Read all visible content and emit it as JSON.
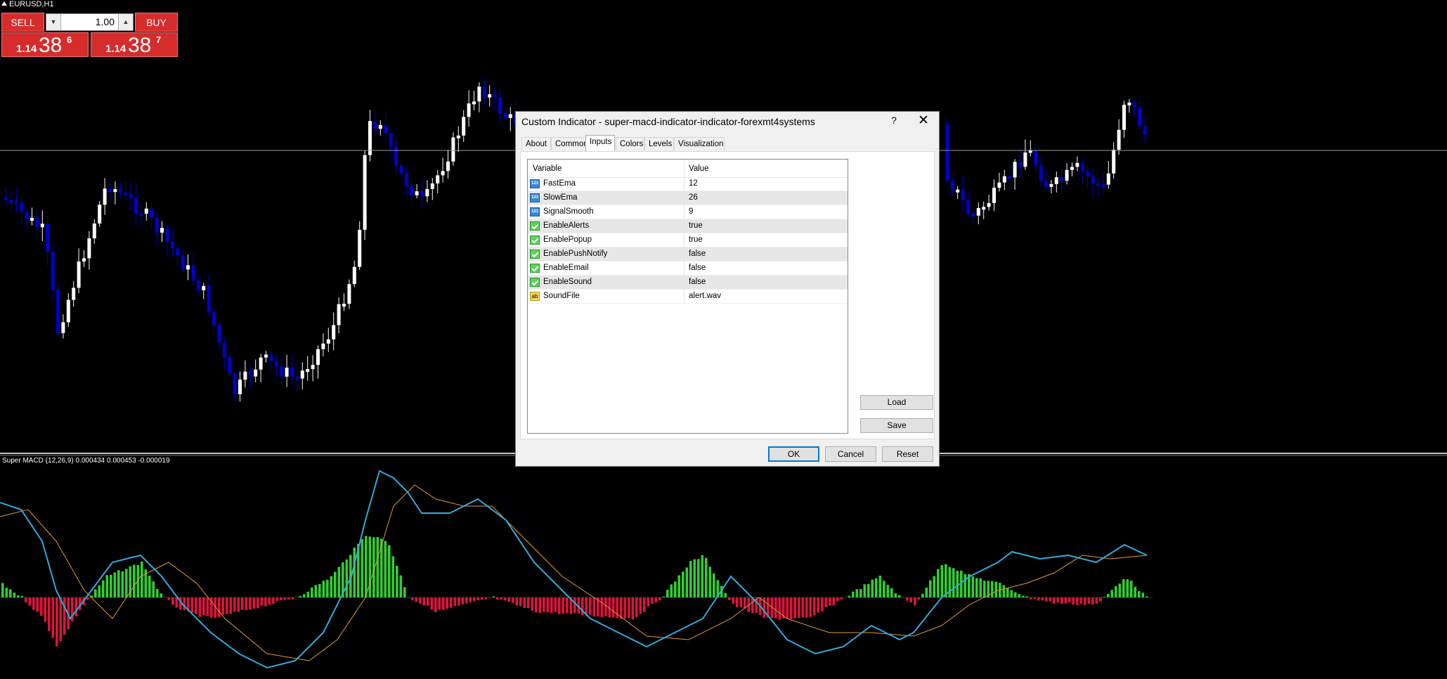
{
  "chart": {
    "symbol_title": "EURUSD,H1",
    "indicator_label": "Super MACD (12,26,9) 0.000434 0.000453 -0.000019",
    "bull_color": "#ffffff",
    "bear_color": "#0000cc",
    "hist_positive_color": "#33cc33",
    "hist_negative_color": "#dc143c",
    "macd_line_color": "#33aadd",
    "signal_line_color": "#e39b3a"
  },
  "trade_panel": {
    "sell_label": "SELL",
    "buy_label": "BUY",
    "lot_value": "1.00",
    "sell_price": {
      "prefix": "1.14",
      "big": "38",
      "sup": "6"
    },
    "buy_price": {
      "prefix": "1.14",
      "big": "38",
      "sup": "7"
    }
  },
  "dialog": {
    "title": "Custom Indicator - super-macd-indicator-indicator-forexmt4systems",
    "help_label": "?",
    "close_label": "✕",
    "tabs": [
      {
        "label": "About"
      },
      {
        "label": "Common"
      },
      {
        "label": "Inputs"
      },
      {
        "label": "Colors"
      },
      {
        "label": "Levels"
      },
      {
        "label": "Visualization"
      }
    ],
    "active_tab": "Inputs",
    "grid": {
      "header_variable": "Variable",
      "header_value": "Value",
      "rows": [
        {
          "icon": "num",
          "name": "FastEma",
          "value": "12"
        },
        {
          "icon": "num",
          "name": "SlowEma",
          "value": "26"
        },
        {
          "icon": "num",
          "name": "SignalSmooth",
          "value": "9"
        },
        {
          "icon": "bool",
          "name": "EnableAlerts",
          "value": "true"
        },
        {
          "icon": "bool",
          "name": "EnablePopup",
          "value": "true"
        },
        {
          "icon": "bool",
          "name": "EnablePushNotify",
          "value": "false"
        },
        {
          "icon": "bool",
          "name": "EnableEmail",
          "value": "false"
        },
        {
          "icon": "bool",
          "name": "EnableSound",
          "value": "false"
        },
        {
          "icon": "str",
          "name": "SoundFile",
          "value": "alert.wav"
        }
      ]
    },
    "load_label": "Load",
    "save_label": "Save",
    "ok_label": "OK",
    "cancel_label": "Cancel",
    "reset_label": "Reset"
  }
}
